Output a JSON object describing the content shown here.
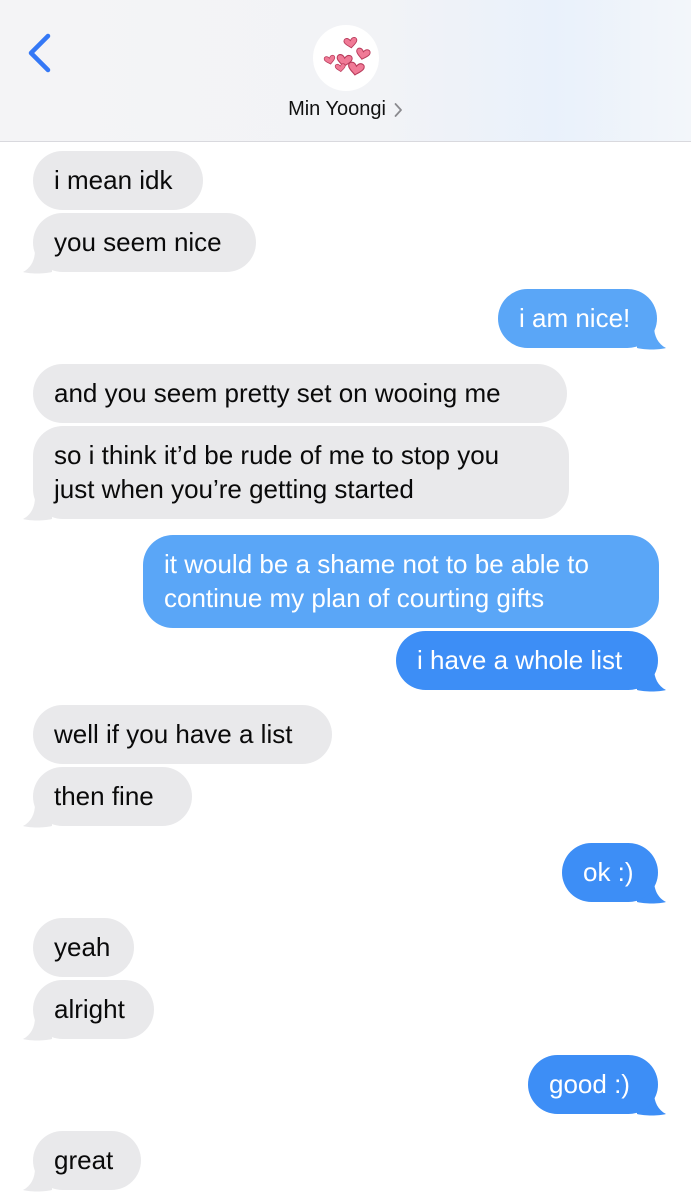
{
  "header": {
    "contact_name": "Min Yoongi",
    "back_icon": "chevron-left-icon",
    "avatar_icon": "hearts-avatar-icon",
    "accent_color": "#3478f6"
  },
  "messages": [
    {
      "side": "received",
      "text": "i mean idk"
    },
    {
      "side": "received",
      "text": "you seem nice"
    },
    {
      "side": "sent",
      "text": "i am nice!"
    },
    {
      "side": "received",
      "text": "and you seem pretty set on wooing me"
    },
    {
      "side": "received",
      "line1": "so i think it’d be rude of me to stop you",
      "line2": "just when you’re getting started"
    },
    {
      "side": "sent",
      "line1": "it would be a shame not to be able to",
      "line2": "continue my plan of courting gifts"
    },
    {
      "side": "sent",
      "text": "i have a whole list"
    },
    {
      "side": "received",
      "text": "well if you have a list"
    },
    {
      "side": "received",
      "text": "then fine"
    },
    {
      "side": "sent",
      "text": "ok :)"
    },
    {
      "side": "received",
      "text": "yeah"
    },
    {
      "side": "received",
      "text": "alright"
    },
    {
      "side": "sent",
      "text": "good :)"
    },
    {
      "side": "received",
      "text": "great"
    }
  ],
  "colors": {
    "received_bubble": "#e9e9eb",
    "sent_bubble": "#3d8ef6",
    "sent_bubble_light": "#5aa6f7",
    "avatar_hearts": "#ea5b7f"
  }
}
